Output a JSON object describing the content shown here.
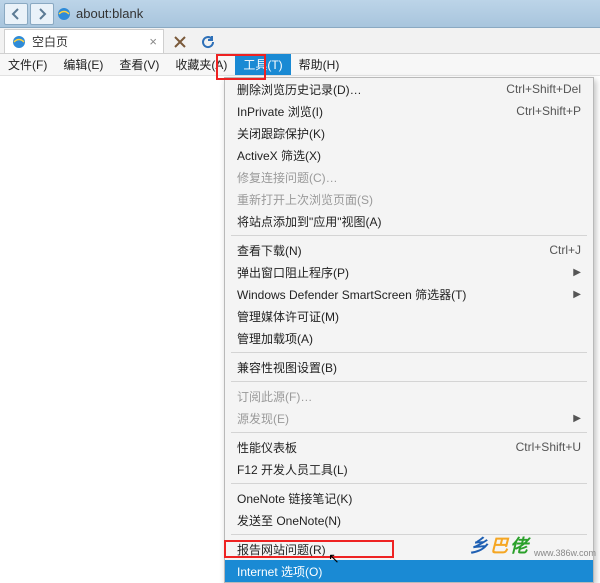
{
  "titlebar": {
    "url": "about:blank"
  },
  "tab": {
    "title": "空白页"
  },
  "menubar": {
    "file": "文件(F)",
    "edit": "编辑(E)",
    "view": "查看(V)",
    "favorites": "收藏夹(A)",
    "tools": "工具(T)",
    "help": "帮助(H)"
  },
  "tools_menu": {
    "groups": [
      [
        {
          "label": "删除浏览历史记录(D)…",
          "shortcut": "Ctrl+Shift+Del"
        },
        {
          "label": "InPrivate 浏览(I)",
          "shortcut": "Ctrl+Shift+P"
        },
        {
          "label": "关闭跟踪保护(K)"
        },
        {
          "label": "ActiveX 筛选(X)"
        },
        {
          "label": "修复连接问题(C)…",
          "disabled": true
        },
        {
          "label": "重新打开上次浏览页面(S)",
          "disabled": true
        },
        {
          "label": "将站点添加到\"应用\"视图(A)"
        }
      ],
      [
        {
          "label": "查看下载(N)",
          "shortcut": "Ctrl+J"
        },
        {
          "label": "弹出窗口阻止程序(P)",
          "submenu": true
        },
        {
          "label": "Windows Defender SmartScreen 筛选器(T)",
          "submenu": true
        },
        {
          "label": "管理媒体许可证(M)"
        },
        {
          "label": "管理加载项(A)"
        }
      ],
      [
        {
          "label": "兼容性视图设置(B)"
        }
      ],
      [
        {
          "label": "订阅此源(F)…",
          "disabled": true
        },
        {
          "label": "源发现(E)",
          "submenu": true,
          "disabled": true
        }
      ],
      [
        {
          "label": "性能仪表板",
          "shortcut": "Ctrl+Shift+U"
        },
        {
          "label": "F12 开发人员工具(L)"
        }
      ],
      [
        {
          "label": "OneNote 链接笔记(K)"
        },
        {
          "label": "发送至 OneNote(N)"
        }
      ],
      [
        {
          "label": "报告网站问题(R)"
        },
        {
          "label": "Internet 选项(O)",
          "selected": true
        }
      ]
    ]
  },
  "watermark": {
    "t1": "乡",
    "t2": "巴",
    "t3": "佬",
    "sub": "www.386w.com"
  }
}
